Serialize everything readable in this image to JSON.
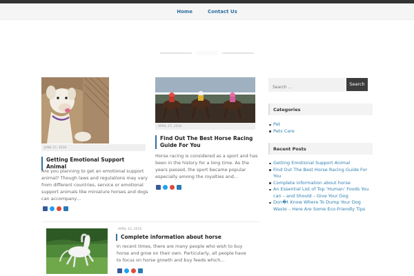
{
  "nav": {
    "items": [
      {
        "label": "Home"
      },
      {
        "label": "Contact Us"
      }
    ]
  },
  "posts": [
    {
      "date": "JUNE 27, 2016",
      "title": "Getting Emotional Support Animal",
      "excerpt": "Are you planning to get an emotional support animal? Though laws and regulations may vary from different countries, service or emotional support animals like miniature horses and dogs can accompany…"
    },
    {
      "date": "APRIL 27, 2016",
      "title": "Find Out The Best Horse Racing Guide For You",
      "excerpt": "Horse racing is considered as a sport and has been in the history for a long time. As the years passed, the sport became popular especially among the royalties and…"
    },
    {
      "date": "APRIL 10, 2016",
      "title": "Complete information about horse",
      "excerpt": "In recent times, there are many people who wish to buy horse and grow on their own. Particularly, all people have to focus on horse growth and buy feeds which…"
    }
  ],
  "sidebar": {
    "search_placeholder": "Search …",
    "search_button": "Search",
    "categories_title": "Categories",
    "categories": [
      "Pet",
      "Pets Care"
    ],
    "recent_title": "Recent Posts",
    "recent": [
      "Getting Emotional Support Animal",
      "Find Out The Best Horse Racing Guide For You",
      "Complete information about horse",
      "An Essential List of Top ‘Human’ Foods You can – and Should – Give Your Dog",
      "Don�t Know Where To Dump Your Dog Waste – Here Are Some Eco-Friendly Tips"
    ]
  },
  "share_icons": [
    "facebook-icon",
    "twitter-icon",
    "googleplus-icon",
    "share-icon"
  ],
  "colors": {
    "accent": "#2f6f9e",
    "facebook": "#3b5998",
    "twitter": "#1da1f2",
    "googleplus": "#dd4b39",
    "share": "#2a7ab8"
  }
}
